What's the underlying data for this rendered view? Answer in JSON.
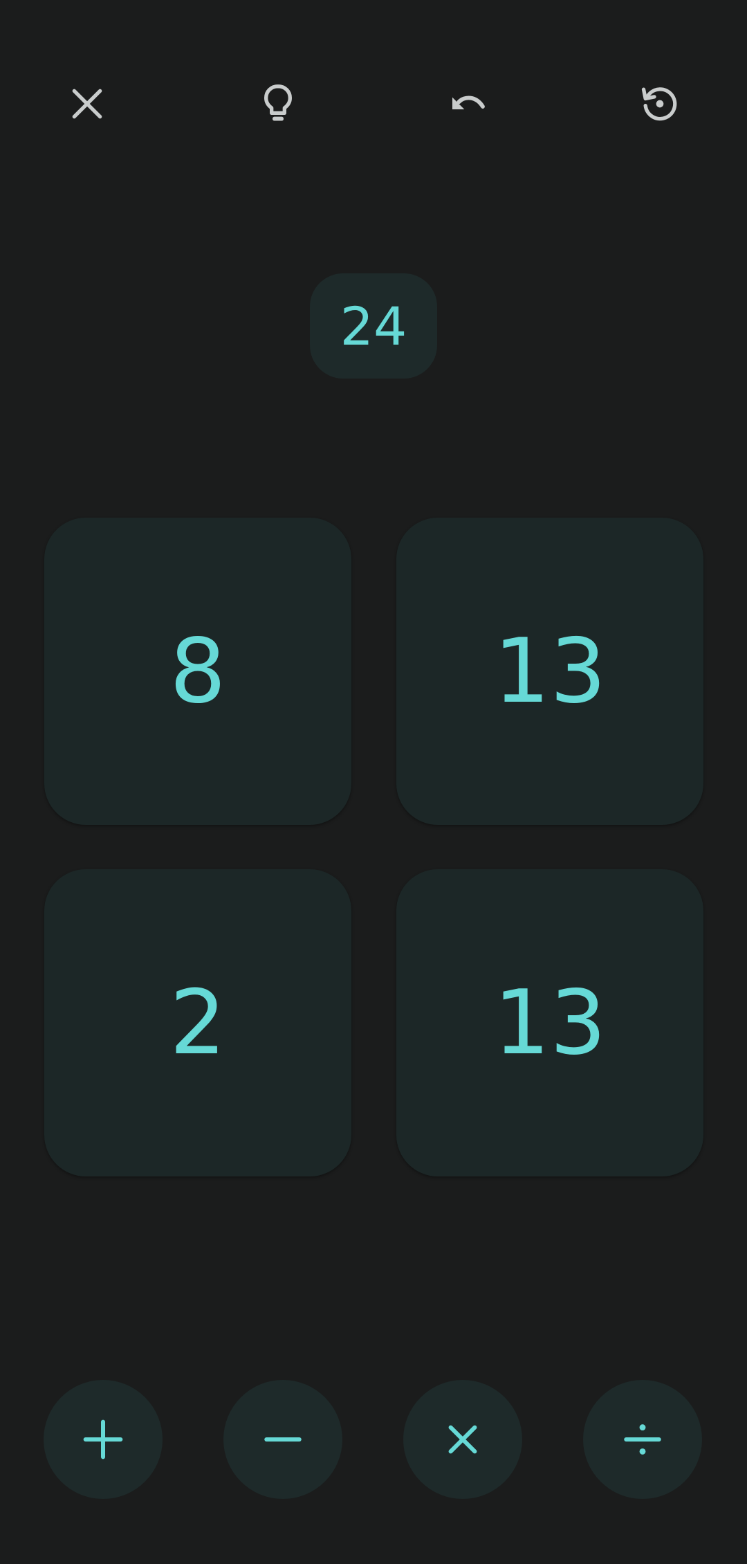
{
  "toolbar": {
    "buttons": [
      {
        "icon": "close-icon"
      },
      {
        "icon": "lightbulb-icon"
      },
      {
        "icon": "undo-icon"
      },
      {
        "icon": "restart-icon"
      }
    ],
    "icon_color": "#c9cccc"
  },
  "target": {
    "value": "24"
  },
  "cards": [
    {
      "value": "8"
    },
    {
      "value": "13"
    },
    {
      "value": "2"
    },
    {
      "value": "13"
    }
  ],
  "operators": [
    {
      "icon": "plus-icon"
    },
    {
      "icon": "minus-icon"
    },
    {
      "icon": "multiply-icon"
    },
    {
      "icon": "divide-icon"
    }
  ],
  "colors": {
    "background": "#1b1c1c",
    "card": "#1c2727",
    "accent": "#66d9d6"
  }
}
